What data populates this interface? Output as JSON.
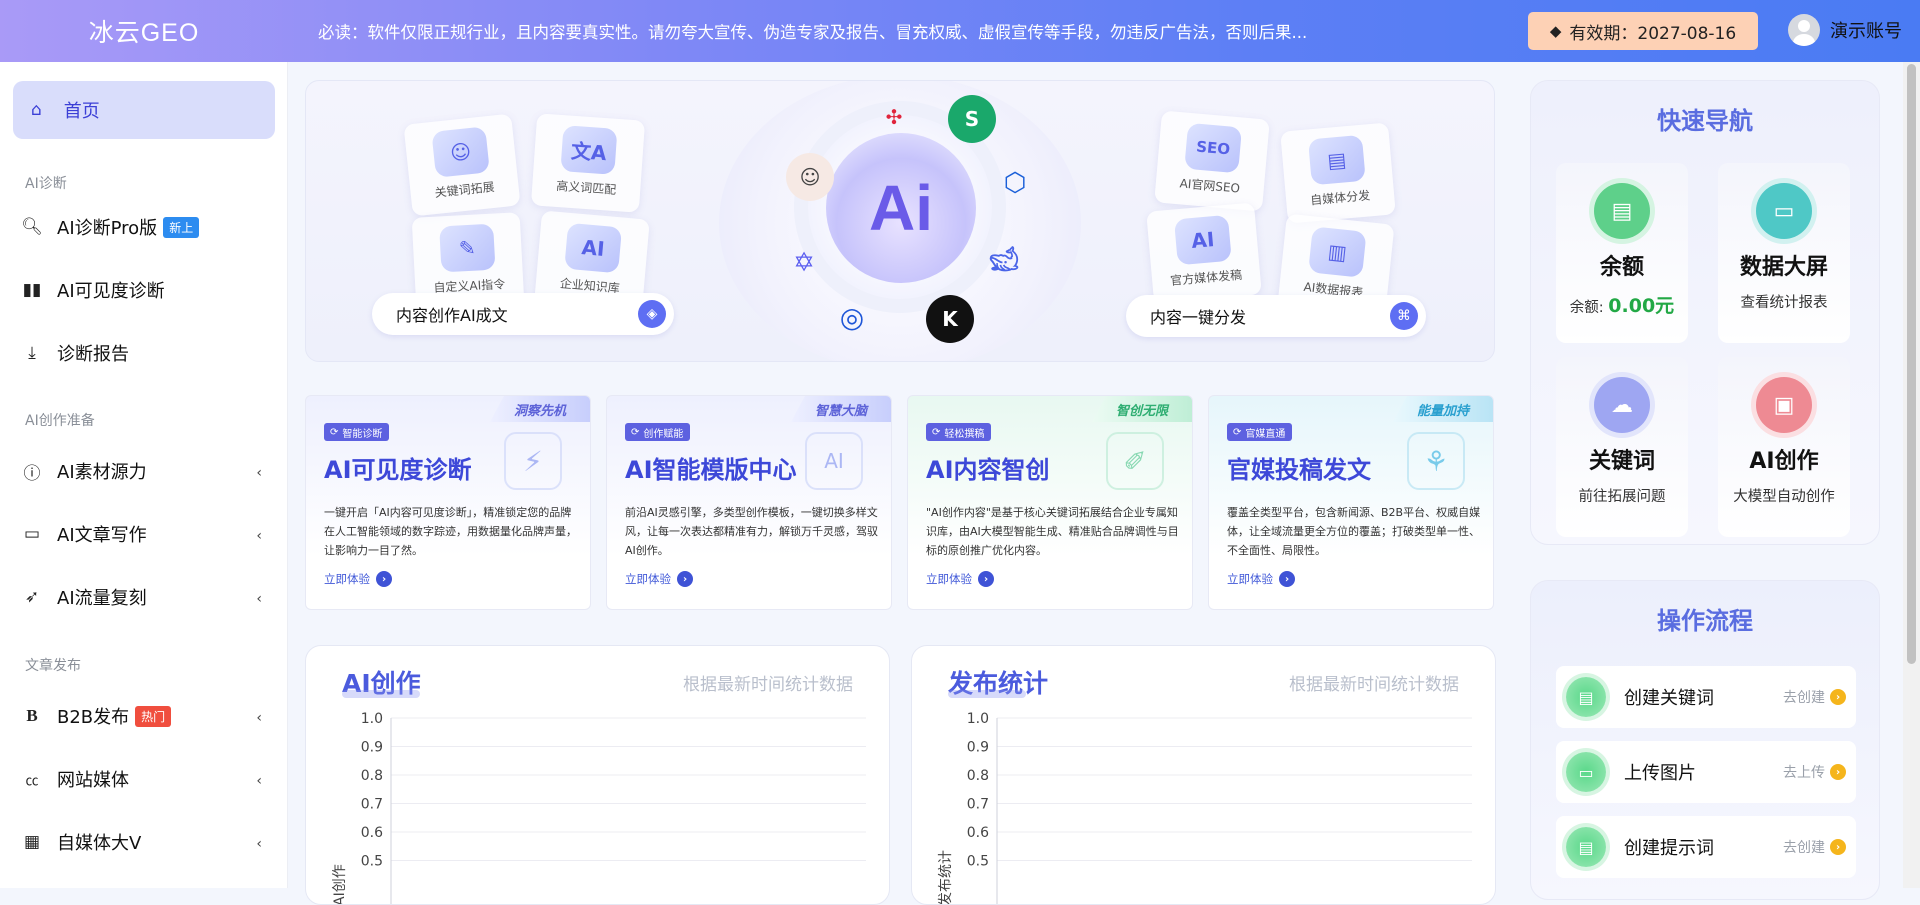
{
  "topbar": {
    "brand": "冰云GEO",
    "notice": "必读：软件仅限正规行业，且内容要真实性。请勿夸大宣传、伪造专家及报告、冒充权威、虚假宣传等手段，勿违反广告法，否则后果...",
    "validity": "有效期：2027-08-16",
    "account": "演示账号"
  },
  "sidebar": {
    "home": "首页",
    "sections": [
      "AI诊断",
      "AI创作准备",
      "文章发布"
    ],
    "items": [
      {
        "label": "AI诊断Pro版",
        "tag": "新上",
        "icon": "search-icon"
      },
      {
        "label": "AI可见度诊断",
        "icon": "bar-chart-icon"
      },
      {
        "label": "诊断报告",
        "icon": "download-icon"
      },
      {
        "label": "AI素材源力",
        "icon": "question-circle-icon"
      },
      {
        "label": "AI文章写作",
        "icon": "folder-icon"
      },
      {
        "label": "AI流量复刻",
        "icon": "rocket-icon"
      },
      {
        "label": "B2B发布",
        "tag": "热门",
        "icon": "bold-b-icon"
      },
      {
        "label": "网站媒体",
        "icon": "cc-icon"
      },
      {
        "label": "自媒体大V",
        "icon": "grid-icon"
      }
    ]
  },
  "hero": {
    "left_tiles": [
      "关键词拓展",
      "高义词匹配",
      "自定义AI指令",
      "企业知识库"
    ],
    "left_pill": "内容创作AI成文",
    "center": "Ai",
    "right_tiles": [
      "AI官网SEO",
      "自媒体分发",
      "官方媒体发稿",
      "AI数据报表"
    ],
    "right_pill": "内容一键分发"
  },
  "cards": [
    {
      "corner": "洞察先机",
      "badge": "智能诊断",
      "title": "AI可见度诊断",
      "desc": "一键开启「AI内容可见度诊断」，精准锁定您的品牌在人工智能领域的数字踪迹，用数据量化品牌声量，让影响力一目了然。",
      "link": "立即体验"
    },
    {
      "corner": "智慧大脑",
      "badge": "创作赋能",
      "title": "AI智能模版中心",
      "desc": "前沿AI灵感引擎，多类型创作模板，一键切换多样文风，让每一次表达都精准有力，解锁万千灵感，驾驭AI创作。",
      "link": "立即体验"
    },
    {
      "corner": "智创无限",
      "badge": "轻松撰稿",
      "title": "AI内容智创",
      "desc": "\"AI创作内容\"是基于核心关键词拓展结合企业专属知识库，由AI大模型智能生成、精准贴合品牌调性与目标的原创推广优化内容。",
      "link": "立即体验"
    },
    {
      "corner": "能量加持",
      "badge": "官媒直通",
      "title": "官媒投稿发文",
      "desc": "覆盖全类型平台，包含新闻源、B2B平台、权威自媒体，让全域流量更全方位的覆盖；打破类型单一性、不全面性、局限性。",
      "link": "立即体验"
    }
  ],
  "panels": [
    {
      "title": "AI创作",
      "subtitle": "根据最新时间统计数据",
      "ylabel": "AI创作"
    },
    {
      "title": "发布统计",
      "subtitle": "根据最新时间统计数据",
      "ylabel": "发布统计"
    }
  ],
  "chart_data": [
    {
      "type": "line",
      "title": "AI创作",
      "ylabel": "AI创作",
      "y_ticks": [
        "1.0",
        "0.9",
        "0.8",
        "0.7",
        "0.6",
        "0.5"
      ],
      "ylim": [
        0,
        1.0
      ],
      "grid": true,
      "series": []
    },
    {
      "type": "line",
      "title": "发布统计",
      "ylabel": "发布统计",
      "y_ticks": [
        "1.0",
        "0.9",
        "0.8",
        "0.7",
        "0.6",
        "0.5"
      ],
      "ylim": [
        0,
        1.0
      ],
      "grid": true,
      "series": []
    }
  ],
  "quick_nav": {
    "title": "快速导航",
    "items": [
      {
        "label": "余额",
        "sub_prefix": "余额: ",
        "sub_value": "0.00元",
        "color": "#5ed08a"
      },
      {
        "label": "数据大屏",
        "sub": "查看统计报表",
        "color": "#4fc8c6"
      },
      {
        "label": "关键词",
        "sub": "前往拓展问题",
        "color": "#9ea6f2"
      },
      {
        "label": "AI创作",
        "sub": "大模型自动创作",
        "color": "#ee8a93"
      }
    ]
  },
  "flow": {
    "title": "操作流程",
    "items": [
      {
        "label": "创建关键词",
        "action": "去创建"
      },
      {
        "label": "上传图片",
        "action": "去上传"
      },
      {
        "label": "创建提示词",
        "action": "去创建"
      }
    ]
  },
  "colors": {
    "accent": "#3d48d8",
    "topbar_start": "#a99af7",
    "topbar_end": "#4a7bf3",
    "tag_new": "#2d8cf0",
    "tag_hot": "#f04e3e",
    "balance": "#22a845"
  }
}
